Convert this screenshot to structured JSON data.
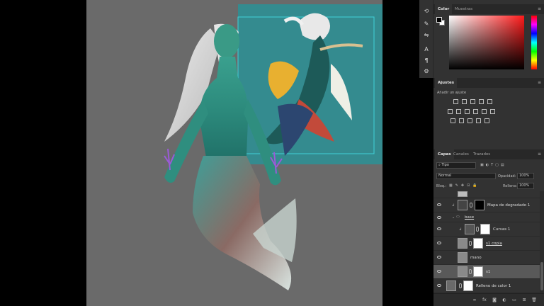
{
  "color_panel": {
    "tabs": [
      "Color",
      "Muestras"
    ],
    "fg_color": "#000000",
    "bg_color": "#ffffff",
    "hue_color": "#ff1a1a"
  },
  "adjust_panel": {
    "tab": "Ajustes",
    "subtitle": "Añadir un ajuste"
  },
  "layers_panel": {
    "tabs": [
      "Capas",
      "Canales",
      "Trazados"
    ],
    "filter_kind": "Tipo",
    "blend_mode": "Normal",
    "opacity_label": "Opacidad:",
    "opacity_value": "100%",
    "lock_label": "Bloq.:",
    "fill_label": "Relleno:",
    "fill_value": "100%",
    "layers": [
      {
        "name": "Mapa de degradado 1",
        "type": "adjustment"
      },
      {
        "name": "base",
        "type": "group"
      },
      {
        "name": "Curvas 1",
        "type": "adjustment"
      },
      {
        "name": "s1 copia",
        "type": "pixel"
      },
      {
        "name": "mano",
        "type": "pixel"
      },
      {
        "name": "s1",
        "type": "pixel",
        "selected": true
      },
      {
        "name": "Relleno de color 1",
        "type": "fill"
      }
    ]
  },
  "colors": {
    "ui_bg": "#323232",
    "doc_bg": "#6a6a6a",
    "selection": "#3fd0d8"
  }
}
